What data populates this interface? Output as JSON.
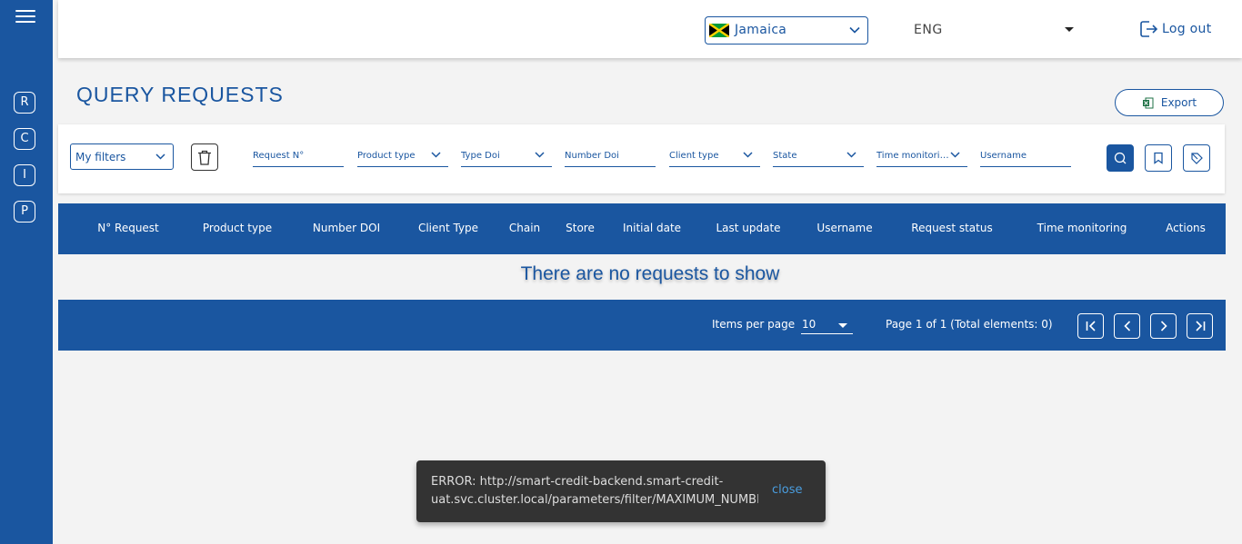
{
  "sidebar": {
    "menu_icon": "hamburger-menu-icon",
    "items": [
      {
        "label": "R"
      },
      {
        "label": "C"
      },
      {
        "label": "I"
      },
      {
        "label": "P"
      }
    ]
  },
  "header": {
    "country": {
      "label": "Jamaica",
      "flag_icon": "jamaica-flag-icon"
    },
    "language": {
      "label": "ENG"
    },
    "logout": {
      "label": "Log out",
      "icon": "logout-icon"
    }
  },
  "page": {
    "title": "QUERY REQUESTS",
    "export_label": "Export"
  },
  "filters": {
    "my_filters": "My filters",
    "fields": [
      {
        "label": "Request N°",
        "dropdown": false
      },
      {
        "label": "Product type",
        "dropdown": true
      },
      {
        "label": "Type Doi",
        "dropdown": true
      },
      {
        "label": "Number Doi",
        "dropdown": false
      },
      {
        "label": "Client type",
        "dropdown": true
      },
      {
        "label": "State",
        "dropdown": true
      },
      {
        "label": "Time monitoring",
        "dropdown": true
      },
      {
        "label": "Username",
        "dropdown": false
      }
    ]
  },
  "table": {
    "columns": [
      "N° Request",
      "Product type",
      "Number DOI",
      "Client Type",
      "Chain",
      "Store",
      "Initial date",
      "Last update",
      "Username",
      "Request status",
      "Time monitoring",
      "Actions"
    ],
    "empty_message": "There are no requests to show"
  },
  "pagination": {
    "items_per_page_label": "Items per page",
    "items_per_page_value": "10",
    "page_info": "Page 1 of 1 (Total elements: 0)"
  },
  "snackbar": {
    "message": "ERROR: http://smart-credit-backend.smart-credit-uat.svc.cluster.local/parameters/filter/MAXIMUM_NUMBER_OF_FILTERS",
    "close_label": "close"
  },
  "colors": {
    "primary": "#1a56a0",
    "snackbar_bg": "#333333",
    "snackbar_link": "#4a9ee0"
  }
}
